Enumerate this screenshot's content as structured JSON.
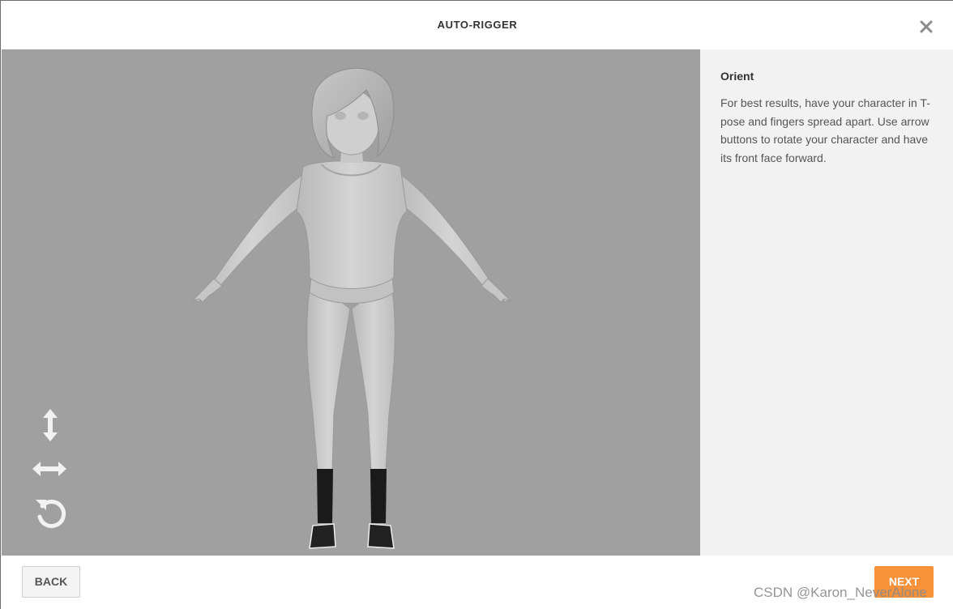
{
  "dialog": {
    "title": "AUTO-RIGGER",
    "close_icon": "close-icon"
  },
  "viewport": {
    "background": "#a0a0a0",
    "controls": [
      {
        "name": "move-vertical-icon"
      },
      {
        "name": "move-horizontal-icon"
      },
      {
        "name": "rotate-icon"
      }
    ]
  },
  "panel": {
    "heading": "Orient",
    "text": "For best results, have your character in T-pose and fingers spread apart. Use arrow buttons to rotate your character and have its front face forward."
  },
  "footer": {
    "back_label": "BACK",
    "next_label": "NEXT",
    "next_color": "#f7923a"
  },
  "watermark": "CSDN @Karon_NeverAlone"
}
